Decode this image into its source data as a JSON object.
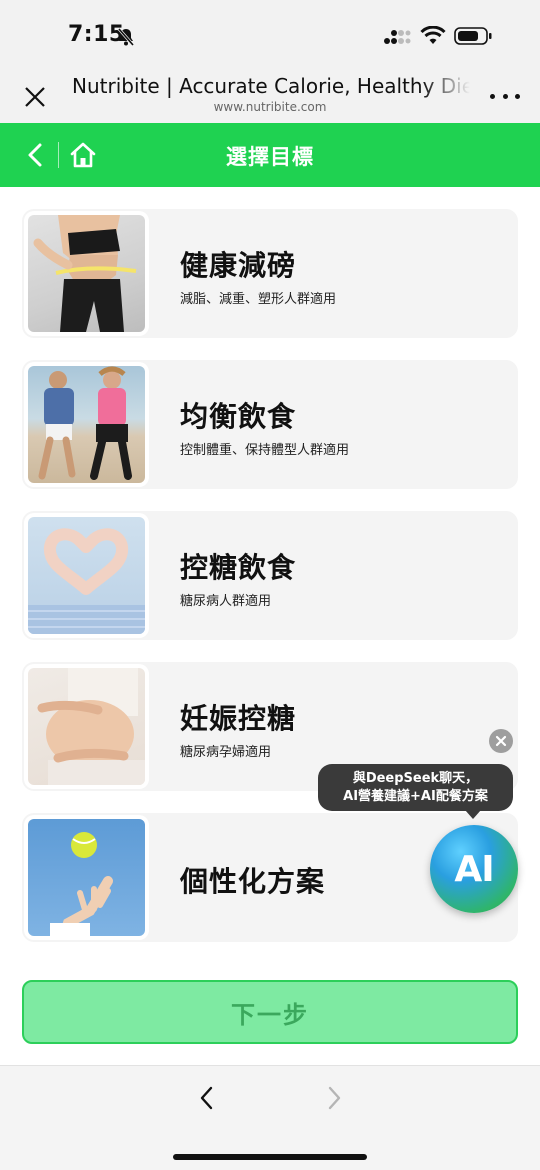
{
  "status_bar": {
    "time": "7:15"
  },
  "browser": {
    "title": "Nutribite | Accurate Calorie, Healthy Diet",
    "url": "www.nutribite.com"
  },
  "header": {
    "title": "選擇目標"
  },
  "goals": [
    {
      "title": "健康減磅",
      "subtitle": "減脂、減重、塑形人群適用"
    },
    {
      "title": "均衡飲食",
      "subtitle": "控制體重、保持體型人群適用"
    },
    {
      "title": "控糖飲食",
      "subtitle": "糖尿病人群適用"
    },
    {
      "title": "妊娠控糖",
      "subtitle": "糖尿病孕婦適用"
    },
    {
      "title": "個性化方案",
      "subtitle": ""
    }
  ],
  "ai_promo": {
    "line1": "與DeepSeek聊天，",
    "line2": "AI營養建議+AI配餐方案",
    "bubble_label": "AI"
  },
  "next_button": {
    "label": "下一步"
  },
  "colors": {
    "brand_green": "#1fd251",
    "button_fill": "#7eeaa2"
  }
}
